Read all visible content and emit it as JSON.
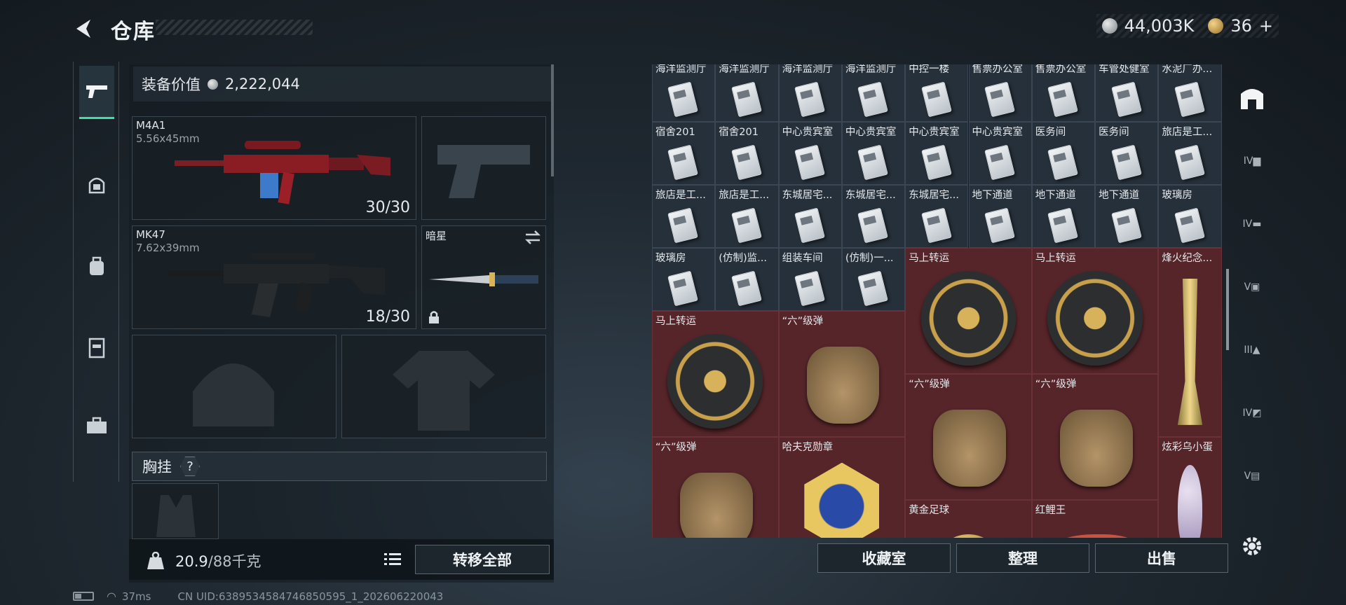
{
  "header": {
    "title": "仓库",
    "currency_silver": "44,003K",
    "currency_gold": "36",
    "add_label": "+"
  },
  "sidebar": {
    "items": [
      {
        "name": "pistol-icon",
        "active": true
      },
      {
        "name": "helmet-icon",
        "active": false
      },
      {
        "name": "backpack-icon",
        "active": false
      },
      {
        "name": "vest-icon",
        "active": false
      },
      {
        "name": "case-icon",
        "active": false
      }
    ]
  },
  "equipment": {
    "value_label": "装备价值",
    "value": "2,222,044",
    "primary": {
      "name": "M4A1",
      "caliber": "5.56x45mm",
      "ammo": "30/30"
    },
    "secondary": {
      "name": "MK47",
      "caliber": "7.62x39mm",
      "ammo": "18/30"
    },
    "melee": {
      "name": "暗星"
    },
    "rig_label": "胸挂",
    "help_label": "?",
    "weight_value": "20.9",
    "weight_capacity": "/88千克",
    "transfer_all_label": "转移全部"
  },
  "storage": {
    "rows": [
      [
        "海洋监测厅",
        "海洋监测厅",
        "海洋监测厅",
        "海洋监测厅",
        "中控一楼",
        "售票办公室",
        "售票办公室",
        "车管处健室",
        "水泥厂办..."
      ],
      [
        "宿舍201",
        "宿舍201",
        "中心贵宾室",
        "中心贵宾室",
        "中心贵宾室",
        "中心贵宾室",
        "医务间",
        "医务间",
        "旅店是工..."
      ],
      [
        "旅店是工...",
        "旅店是工...",
        "东城居宅...",
        "东城居宅...",
        "东城居宅...",
        "地下通道",
        "地下通道",
        "地下通道",
        "玻璃房"
      ],
      [
        "玻璃房",
        "(仿制)监...",
        "组装车间",
        "(仿制)一..."
      ]
    ],
    "large_items": [
      {
        "label": "马上转运",
        "kind": "disc"
      },
      {
        "label": "马上转运",
        "kind": "disc"
      },
      {
        "label": "烽火纪念...",
        "kind": "trophy"
      },
      {
        "label": "马上转运",
        "kind": "disc"
      },
      {
        "label": "“六”级弹",
        "kind": "hand"
      },
      {
        "label": "“六”级弹",
        "kind": "hand"
      },
      {
        "label": "“六”级弹",
        "kind": "hand"
      },
      {
        "label": "“六”级弹",
        "kind": "hand"
      },
      {
        "label": "哈夫克勋章",
        "kind": "medal"
      },
      {
        "label": "黄金足球",
        "kind": "ball"
      },
      {
        "label": "红鲤王",
        "kind": "fish"
      },
      {
        "label": "炫彩乌小蛋",
        "kind": "egg"
      }
    ],
    "buttons": {
      "collection": "收藏室",
      "sort": "整理",
      "sell": "出售"
    }
  },
  "rightbar": {
    "items": [
      "home-icon",
      "case-iv-icon",
      "gun-iv-icon",
      "box-v-icon",
      "tri-iii-icon",
      "tag-iv-icon",
      "bag-v-icon",
      "settings-icon"
    ]
  },
  "status": {
    "ping": "37ms",
    "uid": "CN UID:6389534584746850595_1_202606220043"
  }
}
